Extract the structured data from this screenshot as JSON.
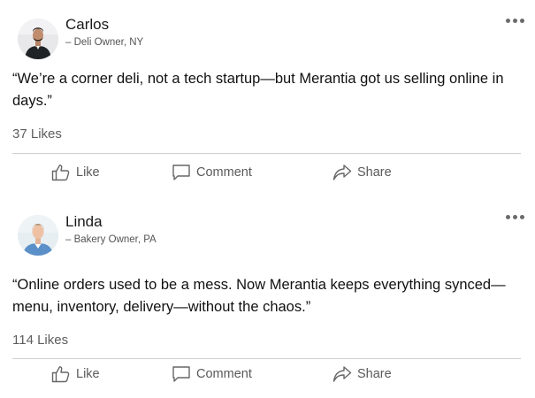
{
  "posts": [
    {
      "author": "Carlos",
      "role": "– Deli Owner, NY",
      "quote": "“We’re a corner deli, not a tech startup—but Merantia got us selling online in days.”",
      "likes": "37 Likes",
      "actions": {
        "like": "Like",
        "comment": "Comment",
        "share": "Share"
      }
    },
    {
      "author": "Linda",
      "role": "– Bakery Owner, PA",
      "quote": "“Online orders used to be a mess. Now Merantia keeps everything synced—menu, inventory, delivery—without the chaos.”",
      "likes": "114 Likes",
      "actions": {
        "like": "Like",
        "comment": "Comment",
        "share": "Share"
      }
    }
  ],
  "icons": {
    "more": "more-dots-icon",
    "like": "thumbs-up-icon",
    "comment": "comment-bubble-icon",
    "share": "share-arrow-icon"
  },
  "colors": {
    "background": "#ffffff",
    "text": "#111111",
    "muted": "#5e5e5e",
    "divider": "#cfcfcf",
    "icon": "#6b6b6b"
  }
}
